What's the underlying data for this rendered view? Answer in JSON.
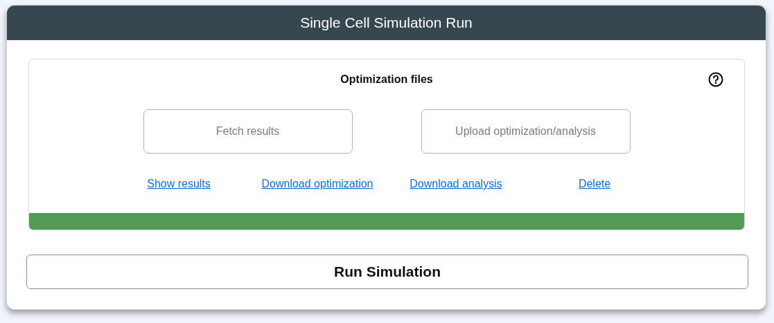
{
  "window": {
    "title": "Single Cell Simulation Run"
  },
  "panel": {
    "title": "Optimization files",
    "buttons": [
      "Fetch results",
      "Upload optimization/analysis"
    ],
    "links": [
      "Show results",
      "Download optimization",
      "Download analysis",
      "Delete"
    ],
    "progress": {
      "level": 1
    }
  },
  "run_button": "Run Simulation"
}
